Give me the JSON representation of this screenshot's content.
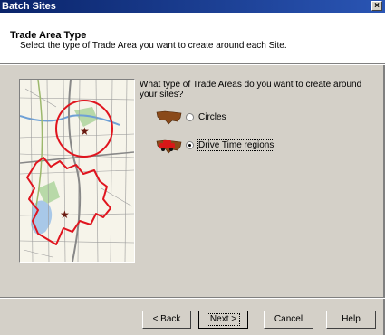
{
  "window": {
    "title": "Batch Sites",
    "close_label": "×"
  },
  "header": {
    "title": "Trade Area Type",
    "subtitle": "Select the type of Trade Area you want to create around each Site."
  },
  "question": "What type of Trade Areas do you want to create around your sites?",
  "options": [
    {
      "label": "Circles",
      "selected": false,
      "icon": "usa-map-icon"
    },
    {
      "label": "Drive Time regions",
      "selected": true,
      "icon": "car-map-icon"
    }
  ],
  "buttons": {
    "back": "< Back",
    "next": "Next >",
    "cancel": "Cancel",
    "help": "Help"
  },
  "colors": {
    "titlebar": "#0a246a",
    "trade_area": "#e0141e",
    "dialog": "#d4d0c8",
    "map_bg": "#f6f4ea"
  }
}
